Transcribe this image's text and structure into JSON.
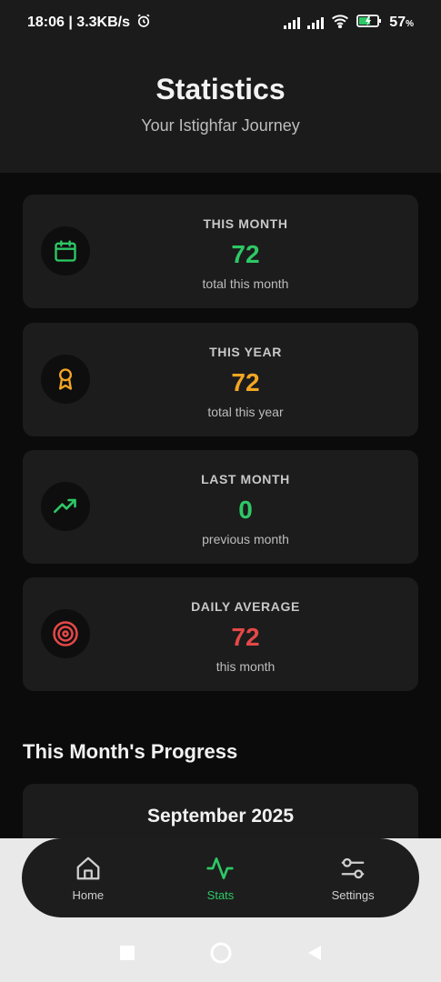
{
  "status_bar": {
    "time_speed": "18:06 | 3.3KB/s",
    "battery": "57",
    "battery_unit": "%"
  },
  "header": {
    "title": "Statistics",
    "subtitle": "Your Istighfar Journey"
  },
  "cards": [
    {
      "label": "THIS MONTH",
      "value": "72",
      "caption": "total this month",
      "icon": "calendar-icon",
      "color": "#2ec866"
    },
    {
      "label": "THIS YEAR",
      "value": "72",
      "caption": "total this year",
      "icon": "award-icon",
      "color": "#f4a623"
    },
    {
      "label": "LAST MONTH",
      "value": "0",
      "caption": "previous month",
      "icon": "trending-up-icon",
      "color": "#2ec866"
    },
    {
      "label": "DAILY AVERAGE",
      "value": "72",
      "caption": "this month",
      "icon": "target-icon",
      "color": "#e54848"
    }
  ],
  "progress": {
    "section_title": "This Month's Progress",
    "month_label": "September 2025"
  },
  "nav": {
    "items": [
      {
        "label": "Home",
        "icon": "home-icon",
        "active": false
      },
      {
        "label": "Stats",
        "icon": "activity-icon",
        "active": true
      },
      {
        "label": "Settings",
        "icon": "sliders-icon",
        "active": false
      }
    ],
    "active_color": "#2ec866"
  }
}
